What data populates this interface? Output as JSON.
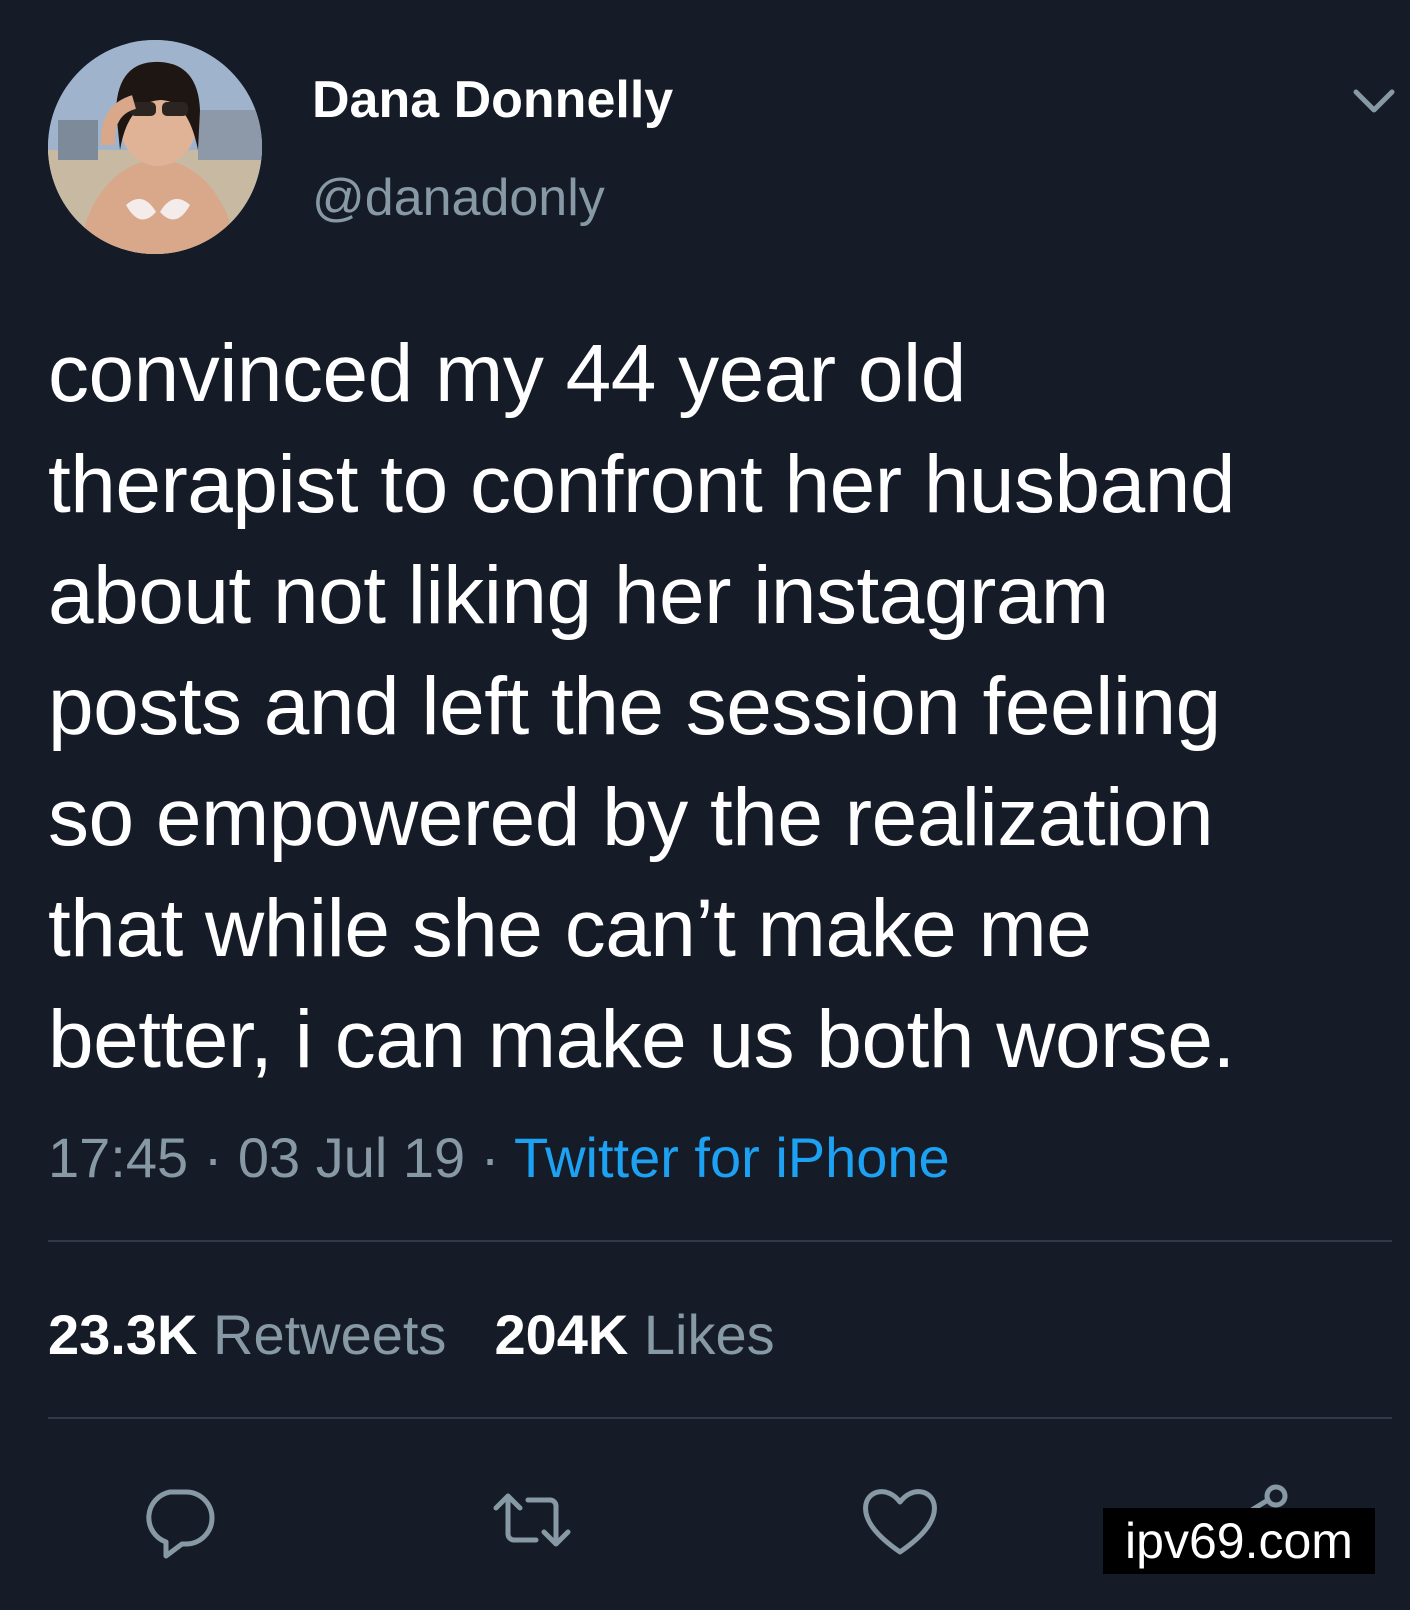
{
  "user": {
    "display_name": "Dana Donnelly",
    "handle": "@danadonly"
  },
  "tweet": {
    "text_lines": [
      "convinced my 44 year old",
      "therapist to confront her husband",
      "about not liking her instagram",
      "posts and left the session feeling",
      "so empowered by the realization",
      "that while she can’t make me",
      "better, i can make us both worse."
    ],
    "time": "17:45",
    "date": "03 Jul 19",
    "separator": " · ",
    "source": "Twitter for iPhone"
  },
  "stats": {
    "retweets_count": "23.3K",
    "retweets_label": "Retweets",
    "likes_count": "204K",
    "likes_label": "Likes"
  },
  "actions": {
    "reply_icon": "reply-icon",
    "retweet_icon": "retweet-icon",
    "like_icon": "heart-icon",
    "share_icon": "share-icon"
  },
  "watermark": "ipv69.com",
  "colors": {
    "background": "#151c27",
    "text_primary": "#ffffff",
    "text_secondary": "#8899a6",
    "link": "#1da1f2",
    "divider": "#2f3a48"
  }
}
